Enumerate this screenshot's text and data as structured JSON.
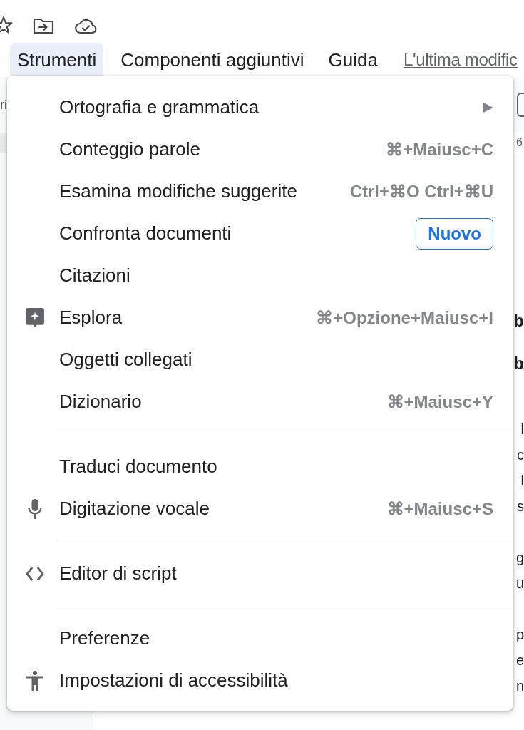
{
  "menu_bar": {
    "items": [
      {
        "label": "Strumenti",
        "selected": true
      },
      {
        "label": "Componenti aggiuntivi",
        "selected": false
      },
      {
        "label": "Guida",
        "selected": false
      }
    ],
    "last_edit": "L'ultima modific"
  },
  "toolbar": {
    "text": "ri"
  },
  "ruler": {
    "number": "6"
  },
  "document": {
    "headings": [
      "b",
      "b"
    ],
    "paragraphs": [
      [
        "l",
        "c",
        "l",
        "s"
      ],
      [
        "g",
        "u"
      ],
      [
        "p",
        "e",
        "n"
      ]
    ]
  },
  "menu": {
    "sections": [
      [
        {
          "kind": "submenu",
          "label": "Ortografia e grammatica"
        },
        {
          "kind": "shortcut",
          "label": "Conteggio parole",
          "shortcut": "⌘+Maiusc+C"
        },
        {
          "kind": "shortcut",
          "label": "Esamina modifiche suggerite",
          "shortcut": "Ctrl+⌘O Ctrl+⌘U"
        },
        {
          "kind": "badge",
          "label": "Confronta documenti",
          "badge": "Nuovo"
        },
        {
          "kind": "plain",
          "label": "Citazioni"
        },
        {
          "kind": "shortcut",
          "label": "Esplora",
          "shortcut": "⌘+Opzione+Maiusc+I"
        },
        {
          "kind": "plain",
          "label": "Oggetti collegati"
        },
        {
          "kind": "shortcut",
          "label": "Dizionario",
          "shortcut": "⌘+Maiusc+Y"
        }
      ],
      [
        {
          "kind": "plain",
          "label": "Traduci documento"
        },
        {
          "kind": "shortcut",
          "label": "Digitazione vocale",
          "shortcut": "⌘+Maiusc+S"
        }
      ],
      [
        {
          "kind": "plain",
          "label": "Editor di script"
        }
      ],
      [
        {
          "kind": "plain",
          "label": "Preferenze"
        },
        {
          "kind": "plain",
          "label": "Impostazioni di accessibilità"
        }
      ]
    ]
  }
}
